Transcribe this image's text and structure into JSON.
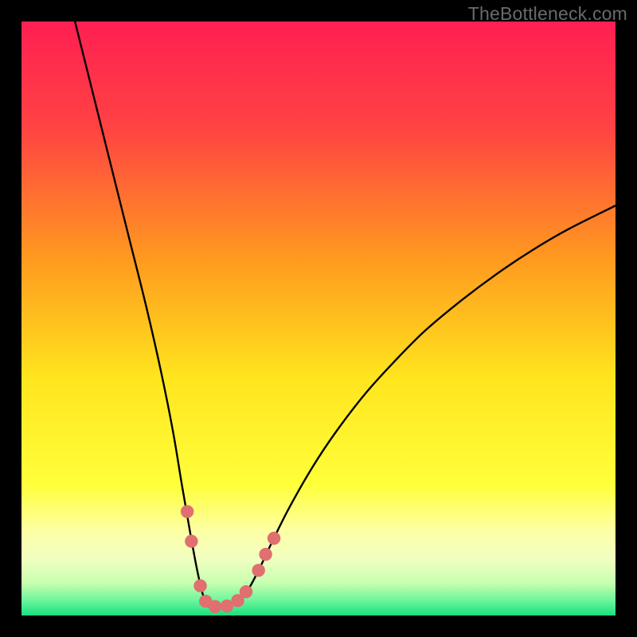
{
  "watermark": "TheBottleneck.com",
  "chart_data": {
    "type": "line",
    "title": "",
    "xlabel": "",
    "ylabel": "",
    "xlim": [
      0,
      100
    ],
    "ylim": [
      0,
      100
    ],
    "grid": false,
    "legend": false,
    "background_gradient_stops": [
      {
        "offset": 0.0,
        "color": "#ff1f52"
      },
      {
        "offset": 0.18,
        "color": "#ff4343"
      },
      {
        "offset": 0.4,
        "color": "#ff9a1f"
      },
      {
        "offset": 0.6,
        "color": "#ffe51e"
      },
      {
        "offset": 0.78,
        "color": "#ffff3a"
      },
      {
        "offset": 0.86,
        "color": "#fdffa8"
      },
      {
        "offset": 0.905,
        "color": "#f0ffc0"
      },
      {
        "offset": 0.945,
        "color": "#c8ffb0"
      },
      {
        "offset": 0.975,
        "color": "#6cf59c"
      },
      {
        "offset": 1.0,
        "color": "#18e07e"
      }
    ],
    "series": [
      {
        "name": "bottleneck-curve",
        "color": "#000000",
        "x": [
          9,
          12,
          15,
          18,
          21,
          23.5,
          25.5,
          27,
          28.3,
          29.4,
          30.3,
          31,
          31.8,
          33.5,
          35,
          36.6,
          38.3,
          40.2,
          42,
          45,
          49,
          53,
          58,
          63,
          68,
          74,
          80,
          86,
          92,
          100
        ],
        "y": [
          100,
          88,
          76,
          64,
          52,
          41,
          31,
          22,
          14.5,
          8.5,
          4.4,
          2.2,
          1.4,
          1.4,
          1.6,
          2.6,
          4.6,
          8.2,
          12,
          18,
          25,
          31,
          37.5,
          43,
          48,
          53,
          57.5,
          61.5,
          65,
          69
        ]
      }
    ],
    "markers": {
      "name": "curve-dots",
      "color": "#e06f6f",
      "radius_pct": 1.1,
      "points": [
        {
          "x": 27.9,
          "y": 17.5
        },
        {
          "x": 28.6,
          "y": 12.5
        },
        {
          "x": 30.1,
          "y": 5.0
        },
        {
          "x": 31.0,
          "y": 2.4
        },
        {
          "x": 32.6,
          "y": 1.5
        },
        {
          "x": 34.6,
          "y": 1.6
        },
        {
          "x": 36.4,
          "y": 2.5
        },
        {
          "x": 37.8,
          "y": 4.0
        },
        {
          "x": 39.9,
          "y": 7.6
        },
        {
          "x": 41.1,
          "y": 10.3
        },
        {
          "x": 42.5,
          "y": 13.0
        }
      ]
    }
  }
}
